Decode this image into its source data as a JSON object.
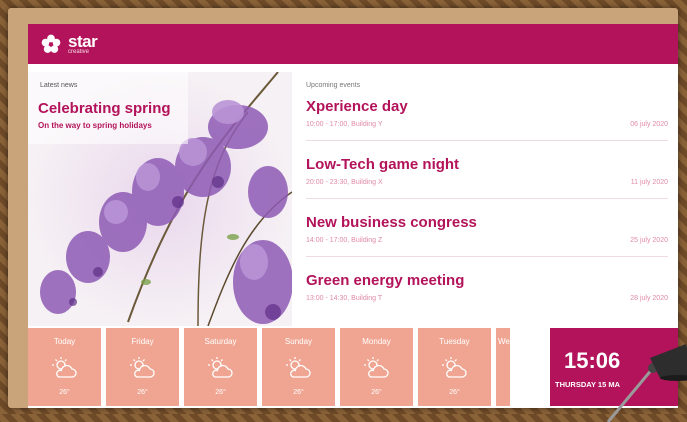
{
  "brand": {
    "name": "star",
    "sub": "creative",
    "color": "#b3135a"
  },
  "news": {
    "label": "Latest news",
    "title": "Celebrating spring",
    "subtitle": "On the way to spring holidays"
  },
  "events": {
    "label": "Upcoming events",
    "items": [
      {
        "title": "Xperience day",
        "meta": "10:00 - 17:00, Building Y",
        "date": "06 july 2020"
      },
      {
        "title": "Low-Tech game night",
        "meta": "20:00 - 23:30, Building X",
        "date": "11 july 2020"
      },
      {
        "title": "New business congress",
        "meta": "14:00 - 17:00, Building Z",
        "date": "25 july 2020"
      },
      {
        "title": "Green energy meeting",
        "meta": "13:00 - 14:30, Building T",
        "date": "28 july 2020"
      }
    ]
  },
  "weather": {
    "icon": "partly-cloudy-icon",
    "days": [
      {
        "name": "Today",
        "temp": "26°"
      },
      {
        "name": "Friday",
        "temp": "26°"
      },
      {
        "name": "Saturday",
        "temp": "26°"
      },
      {
        "name": "Sunday",
        "temp": "26°"
      },
      {
        "name": "Monday",
        "temp": "26°"
      },
      {
        "name": "Tuesday",
        "temp": "26°"
      },
      {
        "name": "Wedn",
        "temp": ""
      }
    ]
  },
  "clock": {
    "time": "15:06",
    "date": "THURSDAY 15 MA"
  }
}
